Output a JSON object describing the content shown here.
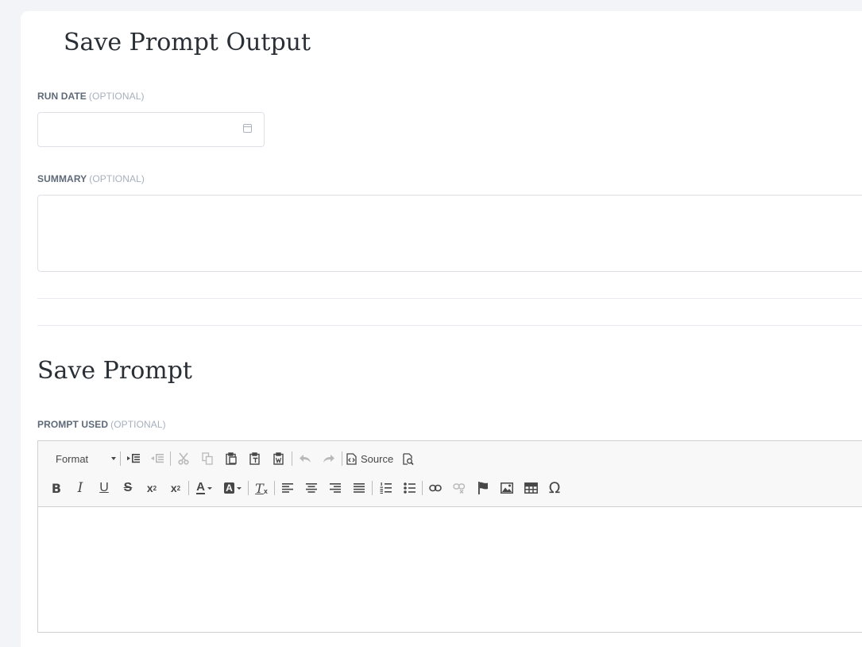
{
  "page": {
    "title": "Save Prompt Output"
  },
  "run_date": {
    "label": "RUN DATE",
    "optional_tag": "(OPTIONAL)",
    "value": "",
    "icon": "calendar-icon"
  },
  "summary": {
    "label": "SUMMARY",
    "optional_tag": "(OPTIONAL)",
    "value": ""
  },
  "prompt_section": {
    "title": "Save Prompt"
  },
  "prompt_used": {
    "label": "PROMPT USED",
    "optional_tag": "(OPTIONAL)",
    "value": ""
  },
  "editor_toolbar": {
    "format_label": "Format",
    "source_label": "Source",
    "row1_icons": [
      "increase-indent-icon",
      "decrease-indent-icon",
      "cut-icon",
      "copy-icon",
      "paste-icon",
      "paste-text-icon",
      "paste-from-word-icon",
      "undo-icon",
      "redo-icon",
      "source-icon",
      "preview-icon"
    ],
    "row2_icons": [
      "bold-icon",
      "italic-icon",
      "underline-icon",
      "strikethrough-icon",
      "subscript-icon",
      "superscript-icon",
      "text-color-icon",
      "background-color-icon",
      "remove-format-icon",
      "align-left-icon",
      "align-center-icon",
      "align-right-icon",
      "justify-icon",
      "numbered-list-icon",
      "bulleted-list-icon",
      "link-icon",
      "unlink-icon",
      "anchor-icon",
      "image-icon",
      "table-icon",
      "special-character-icon"
    ],
    "glyphs": {
      "bold": "B",
      "italic": "I",
      "underline": "U",
      "strike": "S",
      "sub": "x",
      "sub_small": "2",
      "sup": "x",
      "sup_small": "2",
      "text_color": "A",
      "bg_color": "A",
      "remove_format": "T",
      "omega": "Ω"
    }
  },
  "colors": {
    "background": "#f3f4f7",
    "card": "#ffffff",
    "label": "#5f6a78",
    "optional": "#a6b0bd",
    "toolbar": "#f8f8f8"
  }
}
